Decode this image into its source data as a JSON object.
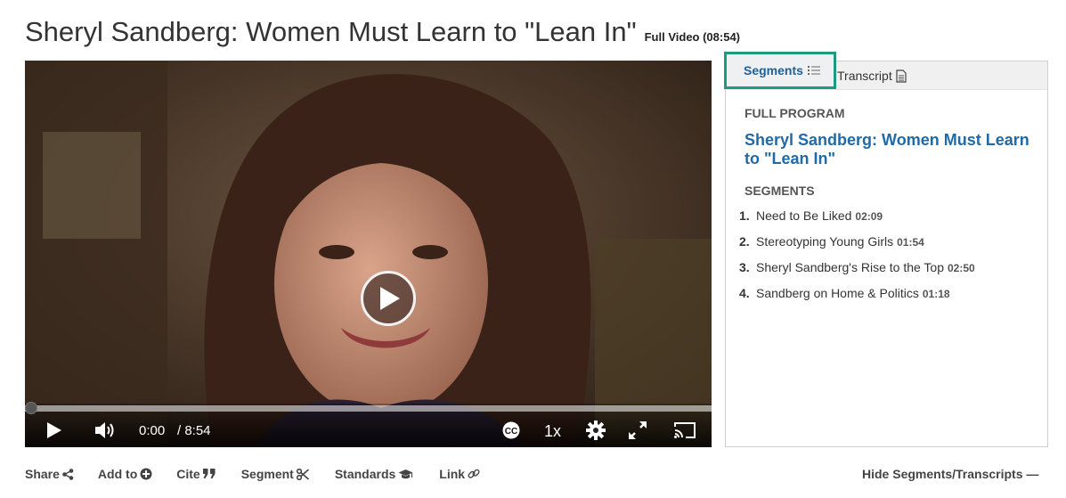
{
  "page": {
    "title": "Sheryl Sandberg: Women Must Learn to \"Lean In\"",
    "duration_label": "Full Video (08:54)"
  },
  "player": {
    "current_time": "0:00",
    "total_time": "/ 8:54",
    "speed": "1x",
    "progress_fraction": 0,
    "icons": [
      "play-icon",
      "volume-icon",
      "closed-captions-icon",
      "settings-gear-icon",
      "fullscreen-icon",
      "cast-icon"
    ]
  },
  "sidebar": {
    "tabs": [
      {
        "label": "Segments",
        "icon": "list-icon",
        "active": true
      },
      {
        "label": "Transcript",
        "icon": "document-icon",
        "active": false
      }
    ],
    "full_program_heading": "FULL PROGRAM",
    "program_title": "Sheryl Sandberg: Women Must Learn to \"Lean In\"",
    "segments_heading": "SEGMENTS",
    "segments": [
      {
        "num": "1.",
        "title": "Need to Be Liked",
        "duration": "02:09"
      },
      {
        "num": "2.",
        "title": "Stereotyping Young Girls",
        "duration": "01:54"
      },
      {
        "num": "3.",
        "title": "Sheryl Sandberg's Rise to the Top",
        "duration": "02:50"
      },
      {
        "num": "4.",
        "title": "Sandberg on Home & Politics",
        "duration": "01:18"
      }
    ]
  },
  "toolbar": {
    "share": "Share",
    "add_to": "Add to",
    "cite": "Cite",
    "segment": "Segment",
    "standards": "Standards",
    "link": "Link",
    "hide": "Hide Segments/Transcripts —"
  },
  "colors": {
    "accent_teal": "#1a9a7f",
    "link_blue": "#1f6aa8"
  }
}
